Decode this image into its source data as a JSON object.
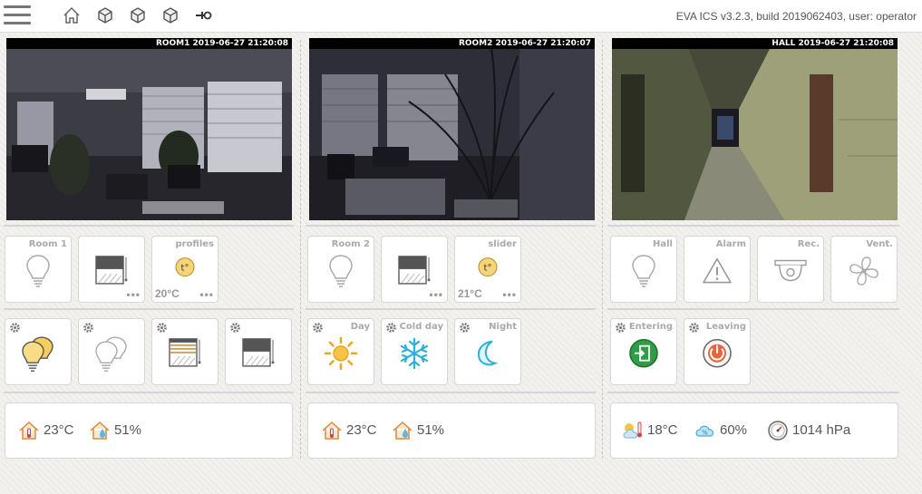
{
  "header": {
    "build_info": "EVA ICS v3.2.3, build 2019062403, user: operator",
    "icons": [
      "menu-icon",
      "home-icon",
      "cube-icon",
      "cube-icon",
      "cube-icon",
      "plug-icon"
    ]
  },
  "cameras": [
    {
      "label": "ROOM1 2019-06-27 21:20:08"
    },
    {
      "label": "ROOM2 2019-06-27 21:20:07"
    },
    {
      "label": "HALL 2019-06-27 21:20:08"
    }
  ],
  "room1": {
    "light": {
      "label": "Room 1"
    },
    "blind": {
      "dots": "•••"
    },
    "profiles": {
      "label": "profiles",
      "value": "20°C",
      "dots": "•••"
    }
  },
  "room2": {
    "light": {
      "label": "Room 2"
    },
    "blind": {
      "dots": "•••"
    },
    "slider": {
      "label": "slider",
      "value": "21°C",
      "dots": "•••"
    },
    "scenes": {
      "day": "Day",
      "cold_day": "Cold day",
      "night": "Night"
    }
  },
  "hall": {
    "hall": "Hall",
    "alarm": "Alarm",
    "rec": "Rec.",
    "vent": "Vent.",
    "entering": "Entering",
    "leaving": "Leaving"
  },
  "sensors": {
    "room1": {
      "temp": "23°C",
      "humidity": "51%"
    },
    "room2": {
      "temp": "23°C",
      "humidity": "51%"
    },
    "outdoor": {
      "temp": "18°C",
      "humidity": "60%",
      "pressure": "1014 hPa"
    }
  },
  "colors": {
    "accent_yellow": "#f2c24a",
    "green": "#2e9e46",
    "orange": "#e8643a",
    "cyan": "#2fb0d8"
  }
}
